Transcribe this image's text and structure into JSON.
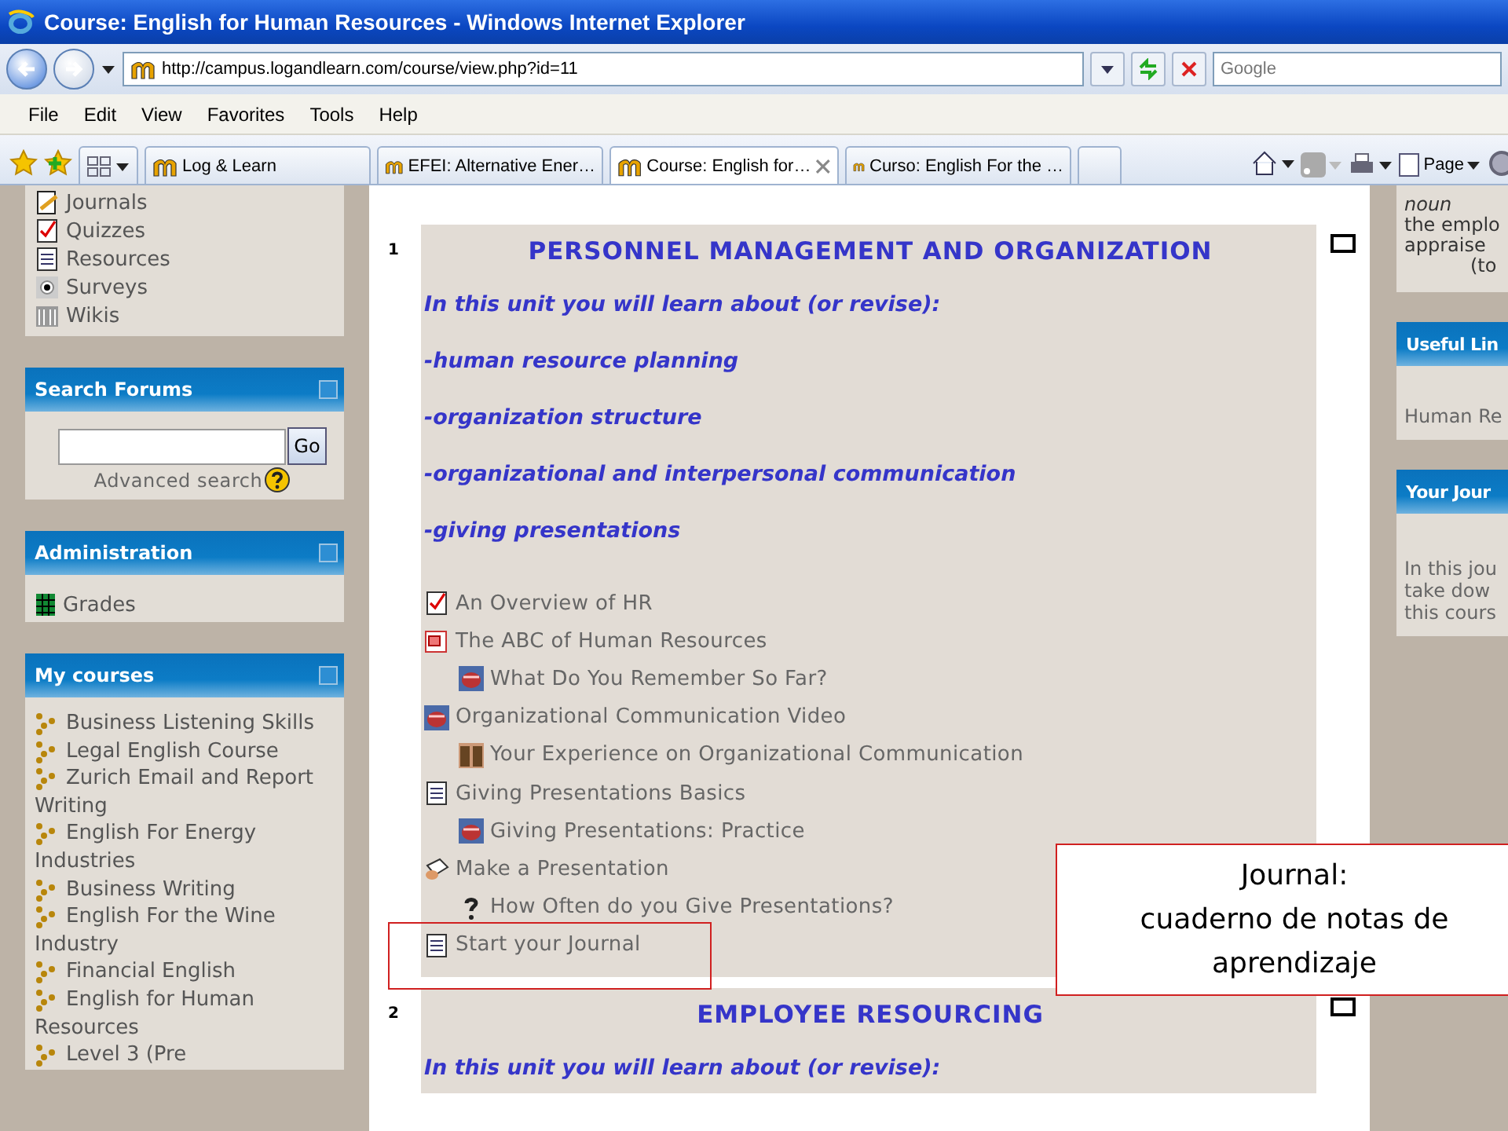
{
  "window": {
    "title": "Course: English for Human Resources - Windows Internet Explorer"
  },
  "address_bar": {
    "url": "http://campus.logandlearn.com/course/view.php?id=11",
    "search_placeholder": "Google"
  },
  "menu": [
    "File",
    "Edit",
    "View",
    "Favorites",
    "Tools",
    "Help"
  ],
  "tabs": [
    {
      "label": "Log & Learn",
      "selected": false
    },
    {
      "label": "EFEI: Alternative Ener…",
      "selected": false
    },
    {
      "label": "Course: English for…",
      "selected": true
    },
    {
      "label": "Curso: English For the …",
      "selected": false
    }
  ],
  "command_bar": {
    "page_label": "Page"
  },
  "left_column": {
    "activity_types": [
      {
        "label": "Journals",
        "kind": "journal"
      },
      {
        "label": "Quizzes",
        "kind": "quiz"
      },
      {
        "label": "Resources",
        "kind": "resource"
      },
      {
        "label": "Surveys",
        "kind": "survey"
      },
      {
        "label": "Wikis",
        "kind": "wiki"
      }
    ],
    "search_forums": {
      "title": "Search Forums",
      "button": "Go",
      "advanced_link": "Advanced search"
    },
    "administration": {
      "title": "Administration",
      "items": [
        "Grades"
      ]
    },
    "my_courses": {
      "title": "My courses",
      "items": [
        "Business Listening Skills",
        "Legal English Course",
        "Zurich Email and Report Writing",
        "English For Energy Industries",
        "Business Writing",
        "English For the Wine Industry",
        "Financial English",
        "English for Human Resources",
        "Level 3 (Pre"
      ]
    }
  },
  "sections": [
    {
      "number": "1",
      "title": "PERSONNEL MANAGEMENT AND ORGANIZATION",
      "intro": "In this unit you will learn about (or revise):",
      "topics": [
        "-human resource planning",
        "-organization structure",
        "-organizational and interpersonal communication",
        "-giving presentations"
      ],
      "checked": false,
      "activities": [
        {
          "label": "An Overview of HR",
          "kind": "quiz",
          "highlighted": false
        },
        {
          "label": "The ABC of Human Resources",
          "kind": "slides",
          "highlighted": false,
          "children": [
            {
              "label": "What Do You Remember So Far?",
              "kind": "forum",
              "highlighted": false
            }
          ]
        },
        {
          "label": "Organizational Communication Video",
          "kind": "forum",
          "highlighted": false,
          "children": [
            {
              "label": "Your Experience on Organizational Communication",
              "kind": "chat",
              "highlighted": false
            }
          ]
        },
        {
          "label": "Giving Presentations Basics",
          "kind": "page",
          "highlighted": false,
          "children": [
            {
              "label": "Giving Presentations: Practice",
              "kind": "forum",
              "highlighted": false
            }
          ]
        },
        {
          "label": "Make a Presentation",
          "kind": "assignment",
          "highlighted": false,
          "children": [
            {
              "label": "How Often do you Give Presentations?",
              "kind": "question",
              "highlighted": false
            }
          ]
        },
        {
          "label": "Start your Journal",
          "kind": "page",
          "highlighted": true
        }
      ]
    },
    {
      "number": "2",
      "title": "EMPLOYEE RESOURCING",
      "intro": "In this unit you will learn about (or revise):",
      "checked": false
    }
  ],
  "right_column": {
    "glossary": {
      "word_class": "noun",
      "lines": [
        "the emplo",
        "appraise",
        "(to"
      ]
    },
    "useful_links": {
      "title": "Useful Lin",
      "items": [
        "Human Re"
      ]
    },
    "journal": {
      "title": "Your Jour",
      "lines": [
        "In this jou",
        "take dow",
        "this cours"
      ]
    }
  },
  "callout": {
    "text": "Journal:\ncuaderno de notas de aprendizaje"
  }
}
